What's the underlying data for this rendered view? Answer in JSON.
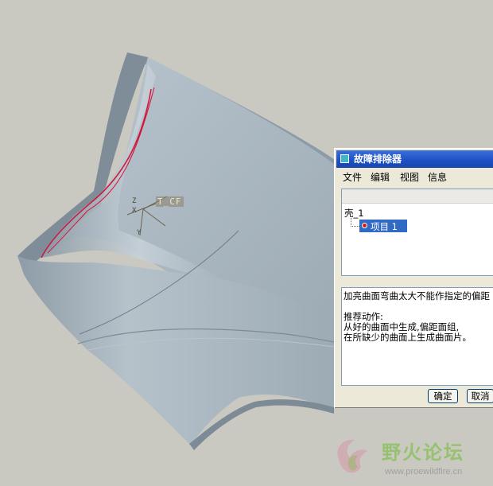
{
  "viewport": {
    "background": "#c9c9c2",
    "model_color": "#a2b0ba",
    "highlight_edge_color": "#d2143a",
    "csys_label": "T_CF",
    "axis_labels": {
      "z": "Z",
      "x": "X",
      "y": "Y"
    }
  },
  "dialog": {
    "title": "故障排除器",
    "title_icon": "window-icon",
    "menu": [
      "文件",
      "编辑",
      "视图",
      "信息"
    ],
    "tree": {
      "root": "壳_1",
      "child": "项目 1",
      "child_icon": "error-dot-icon"
    },
    "message_lines": [
      "加亮曲面弯曲太大不能作指定的偏距",
      "",
      "推荐动作:",
      "      从好的曲面中生成,偏距面组,",
      "在所缺少的曲面上生成曲面片。"
    ],
    "buttons": {
      "ok": "确定",
      "cancel": "取消"
    }
  },
  "watermark": {
    "title": "野火论坛",
    "url": "www.proewildfire.cn"
  }
}
